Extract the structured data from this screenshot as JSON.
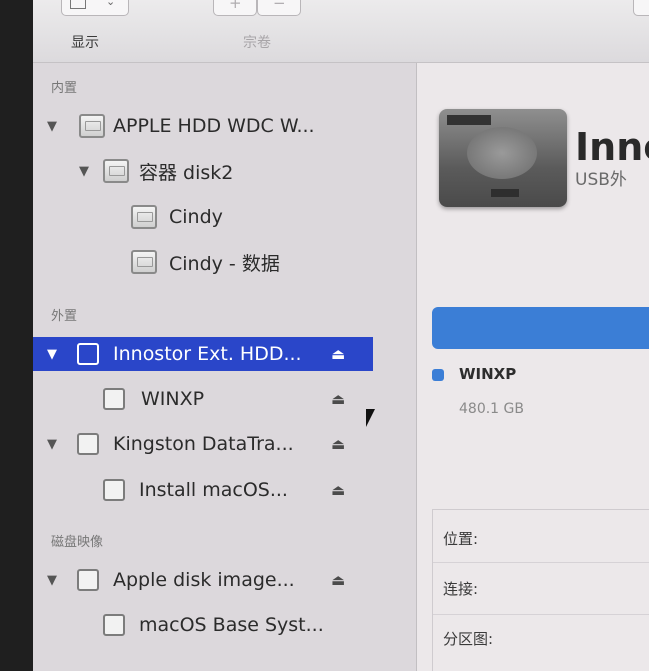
{
  "toolbar": {
    "view_label": "显示",
    "volume_label": "宗卷",
    "add_symbol": "+",
    "remove_symbol": "−"
  },
  "sidebar": {
    "sections": [
      {
        "header": "内置"
      },
      {
        "header": "外置"
      },
      {
        "header": "磁盘映像"
      }
    ],
    "items": [
      {
        "label": "APPLE HDD WDC W...",
        "expanded": true,
        "eject": ""
      },
      {
        "label": "容器 disk2",
        "expanded": true,
        "eject": ""
      },
      {
        "label": "Cindy",
        "eject": ""
      },
      {
        "label": "Cindy - 数据",
        "eject": ""
      },
      {
        "label": "Innostor Ext. HDD...",
        "expanded": true,
        "eject": "⏏"
      },
      {
        "label": "WINXP",
        "eject": "⏏"
      },
      {
        "label": "Kingston DataTra...",
        "expanded": true,
        "eject": "⏏"
      },
      {
        "label": "Install macOS...",
        "eject": "⏏"
      },
      {
        "label": "Apple disk image...",
        "expanded": true,
        "eject": "⏏"
      },
      {
        "label": "macOS Base Syst...",
        "eject": ""
      }
    ],
    "triangle": "▼"
  },
  "main": {
    "device_title": "Innc",
    "device_subtitle": "USB外",
    "volume": {
      "name": "WINXP",
      "size": "480.1 GB",
      "color": "#3b7ed6"
    },
    "info_labels": [
      "位置:",
      "连接:",
      "分区图:"
    ]
  },
  "colors": {
    "selection": "#2a46c9",
    "sidebar_bg": "#dcd8dc",
    "accent": "#3b7ed6"
  }
}
